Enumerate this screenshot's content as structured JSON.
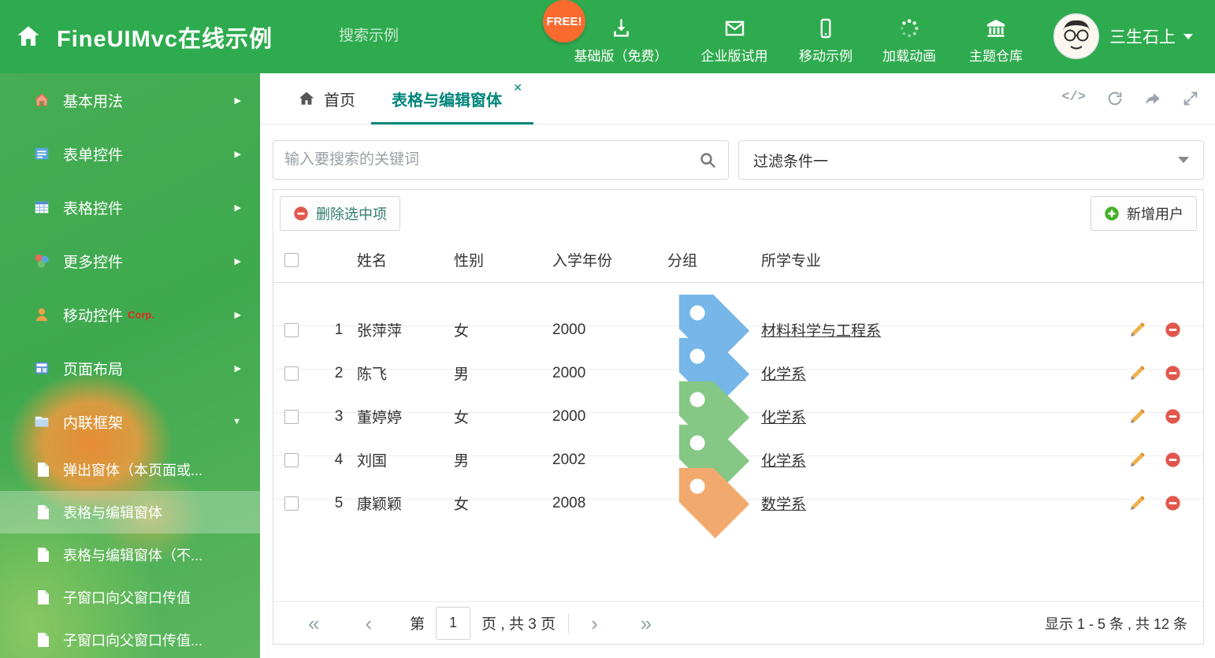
{
  "colors": {
    "header_green": "#2fab4f",
    "accent_teal": "#00857a",
    "free_badge_orange": "#f96a2e",
    "delete_red": "#e2574c",
    "add_green": "#45b029",
    "pencil_orange": "#efb14e",
    "corp_red": "#e02b20"
  },
  "header": {
    "title": "FineUIMvc在线示例",
    "search_placeholder": "搜索示例",
    "free_badge": "FREE!",
    "nav": [
      {
        "label": "基础版（免费）",
        "icon": "download-icon"
      },
      {
        "label": "企业版试用",
        "icon": "envelope-icon"
      },
      {
        "label": "移动示例",
        "icon": "mobile-icon"
      },
      {
        "label": "加载动画",
        "icon": "spinner-icon"
      },
      {
        "label": "主题仓库",
        "icon": "bank-icon"
      }
    ],
    "user_name": "三生石上"
  },
  "sidebar": {
    "items": [
      {
        "label": "基本用法"
      },
      {
        "label": "表单控件"
      },
      {
        "label": "表格控件"
      },
      {
        "label": "更多控件"
      },
      {
        "label": "移动控件",
        "badge": "Corp."
      },
      {
        "label": "页面布局"
      },
      {
        "label": "内联框架"
      }
    ],
    "subitems": [
      {
        "label": "弹出窗体（本页面或..."
      },
      {
        "label": "表格与编辑窗体"
      },
      {
        "label": "表格与编辑窗体（不..."
      },
      {
        "label": "子窗口向父窗口传值"
      },
      {
        "label": "子窗口向父窗口传值..."
      }
    ]
  },
  "tabs": {
    "home": "首页",
    "active": "表格与编辑窗体"
  },
  "main": {
    "search_placeholder": "输入要搜索的关键词",
    "filter_value": "过滤条件一",
    "toolbar": {
      "delete_label": "删除选中项",
      "add_label": "新增用户"
    },
    "table": {
      "columns": {
        "name": "姓名",
        "gender": "性别",
        "year": "入学年份",
        "group": "分组",
        "major": "所学专业"
      },
      "rows": [
        {
          "num": "1",
          "name": "张萍萍",
          "gender": "女",
          "year": "2000",
          "tag_color": "#76b6e8",
          "major": "材料科学与工程系"
        },
        {
          "num": "2",
          "name": "陈飞",
          "gender": "男",
          "year": "2000",
          "tag_color": "#76b6e8",
          "major": "化学系"
        },
        {
          "num": "3",
          "name": "董婷婷",
          "gender": "女",
          "year": "2000",
          "tag_color": "#85c785",
          "major": "化学系"
        },
        {
          "num": "4",
          "name": "刘国",
          "gender": "男",
          "year": "2002",
          "tag_color": "#85c785",
          "major": "化学系"
        },
        {
          "num": "5",
          "name": "康颖颖",
          "gender": "女",
          "year": "2008",
          "tag_color": "#f2a96d",
          "major": "数学系"
        }
      ]
    },
    "pagination": {
      "page_prefix": "第",
      "page_value": "1",
      "page_suffix": "页 , 共 3 页",
      "summary": "显示 1 - 5 条 , 共 12 条"
    }
  }
}
